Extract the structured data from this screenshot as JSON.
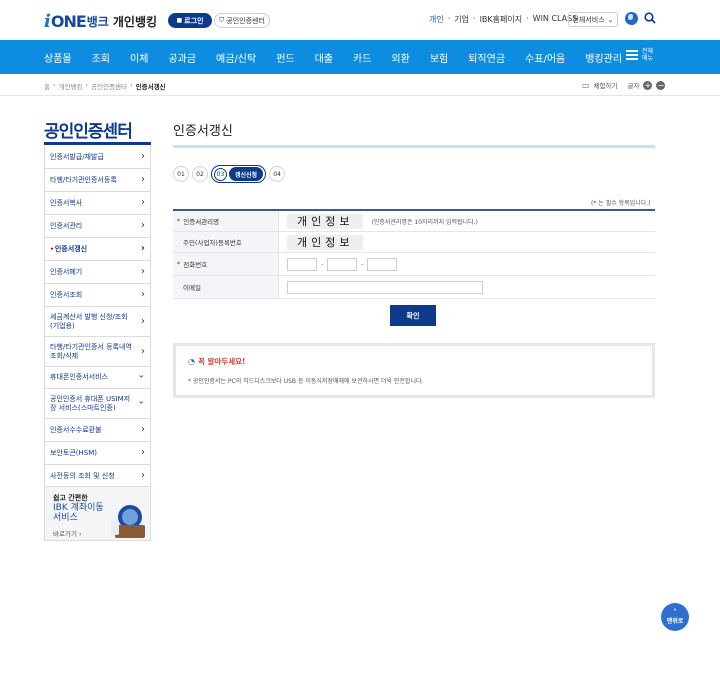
{
  "header": {
    "logo_i": "i",
    "logo_one": "ONE",
    "logo_bank": "뱅크",
    "logo_sub": "개인뱅킹",
    "login_label": "로그인",
    "cert_center_label": "공인인증센터",
    "top_links": [
      "개인",
      "·",
      "기업",
      "·",
      "IBK홈페이지",
      "·",
      "WIN CLASS"
    ],
    "all_services_label": "전체서비스",
    "brand_color": "#0e3a8c",
    "nav_color": "#0e8de0"
  },
  "nav": {
    "items": [
      "상품몰",
      "조회",
      "이체",
      "공과금",
      "예금/신탁",
      "펀드",
      "대출",
      "카드",
      "외환",
      "보험",
      "퇴직연금",
      "수표/어음",
      "뱅킹관리"
    ],
    "all_menu_label": "전체메뉴"
  },
  "breadcrumb": {
    "items": [
      "홈",
      "›",
      "개인뱅킹",
      "›",
      "공인인증센터",
      "›"
    ],
    "current": "인증서갱신",
    "experience_label": "체험하기",
    "font_label": "글자"
  },
  "sidebar": {
    "title": "공인인증센터",
    "items": [
      {
        "label": "인증서발급/재발급"
      },
      {
        "label": "타행/타기관인증서등록"
      },
      {
        "label": "인증서복사"
      },
      {
        "label": "인증서관리"
      },
      {
        "label": "인증서갱신"
      },
      {
        "label": "인증서폐기"
      },
      {
        "label": "인증서조회"
      },
      {
        "label": "세금계산서 발행 신청/조회(기업용)"
      },
      {
        "label": "타행/타기관인증서 등록내역 조회/삭제"
      },
      {
        "label": "휴대폰인증서서비스"
      },
      {
        "label": "공인인증서 휴대폰 USIM저장 서비스(스마트인증)"
      },
      {
        "label": "인증서수수료환불"
      },
      {
        "label": "보안토큰(HSM)"
      },
      {
        "label": "사전등의 조회 및 신청"
      }
    ],
    "banner": {
      "line1": "쉽고 간편한",
      "line2": "IBK 계좌이동 서비스",
      "link": "바로가기 ›"
    }
  },
  "main": {
    "title": "인증서갱신",
    "steps": [
      "01",
      "02",
      "03",
      "04"
    ],
    "current_step_label": "갱신신청",
    "required_note_star": "*",
    "required_note": "는 필수 항목입니다.",
    "form": {
      "cert_name_label": "인증서관리명",
      "cert_name_value": "개인정보",
      "cert_name_hint": "(인증서관리명은 10자리까지 입력됩니다.)",
      "id_number_label": "주민(사업자)등록번호",
      "id_number_value": "개인정보",
      "phone_label": "전화번호",
      "phone_sep": "-",
      "email_label": "이메일"
    },
    "confirm_label": "확인",
    "notice": {
      "title": "꼭 알아두세요!",
      "text": "* 공인인증서는 PC의 하드디스크보다 USB 등 이동식저장매체에 보관하시면 더욱 안전합니다."
    }
  },
  "top_button": {
    "label": "맨위로"
  }
}
